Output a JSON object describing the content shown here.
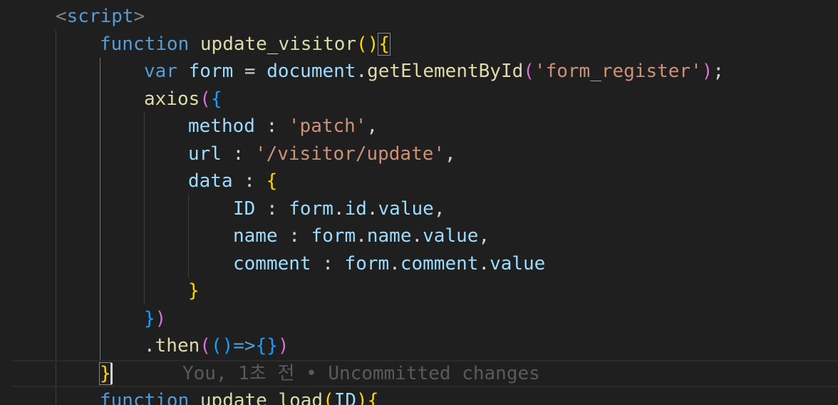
{
  "editor": {
    "language": "html/javascript",
    "cursor_line_blame": "You, 1초 전 • Uncommitted changes"
  },
  "colors": {
    "background": "#1f1f1f",
    "keyword": "#569cd6",
    "function": "#dcdcaa",
    "variable": "#9cdcfe",
    "string": "#ce9178",
    "bracket_level_1": "#ffd700",
    "bracket_level_2": "#da70d6",
    "bracket_level_3": "#179fff"
  },
  "tokens": {
    "l1": [
      "<",
      "script",
      ">"
    ],
    "l2": [
      "function",
      " ",
      "update_visitor",
      "(",
      ")",
      "{"
    ],
    "l3": [
      "var",
      " ",
      "form",
      " = ",
      "document",
      ".",
      "getElementById",
      "(",
      "'form_register'",
      ")",
      ";"
    ],
    "l4": [
      "axios",
      "(",
      "{"
    ],
    "l5": [
      "method",
      " : ",
      "'patch'",
      ","
    ],
    "l6": [
      "url",
      " : ",
      "'/visitor/update'",
      ","
    ],
    "l7": [
      "data",
      " : ",
      "{"
    ],
    "l8": [
      "ID",
      " : ",
      "form",
      ".",
      "id",
      ".",
      "value",
      ","
    ],
    "l9": [
      "name",
      " : ",
      "form",
      ".",
      "name",
      ".",
      "value",
      ","
    ],
    "l10": [
      "comment",
      " : ",
      "form",
      ".",
      "comment",
      ".",
      "value"
    ],
    "l11": [
      "}"
    ],
    "l12": [
      "}",
      ")"
    ],
    "l13": [
      ".",
      "then",
      "(",
      "(",
      ")",
      "=>",
      "{",
      "}",
      ")"
    ],
    "l14": [
      "}"
    ],
    "l15": [
      "function",
      " ",
      "update_load",
      "(",
      "ID",
      ")",
      "{"
    ]
  }
}
